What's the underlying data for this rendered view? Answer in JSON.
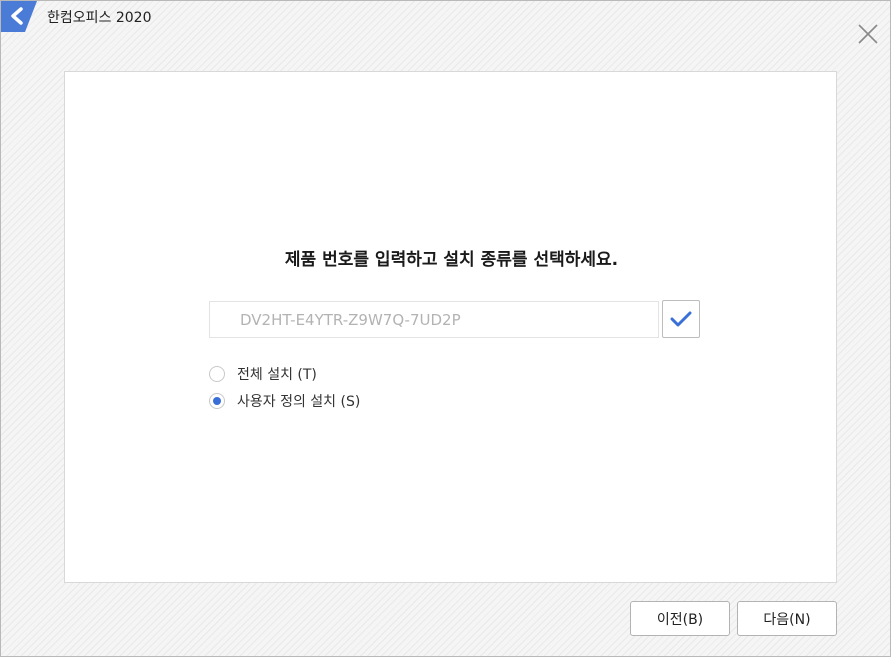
{
  "window": {
    "title": "한컴오피스 2020",
    "logo_icon": "hancom-logo-icon",
    "close_icon": "close-icon",
    "accent_color": "#3a6fd8"
  },
  "main": {
    "heading": "제품 번호를 입력하고 설치 종류를 선택하세요.",
    "product_key": {
      "value": "DV2HT-E4YTR-Z9W7Q-7UD2P",
      "placeholder": ""
    },
    "verify_icon": "check-icon",
    "install_options": [
      {
        "label": "전체 설치 (T)",
        "selected": false
      },
      {
        "label": "사용자 정의 설치 (S)",
        "selected": true
      }
    ]
  },
  "footer": {
    "prev_label": "이전(B)",
    "next_label": "다음(N)"
  }
}
